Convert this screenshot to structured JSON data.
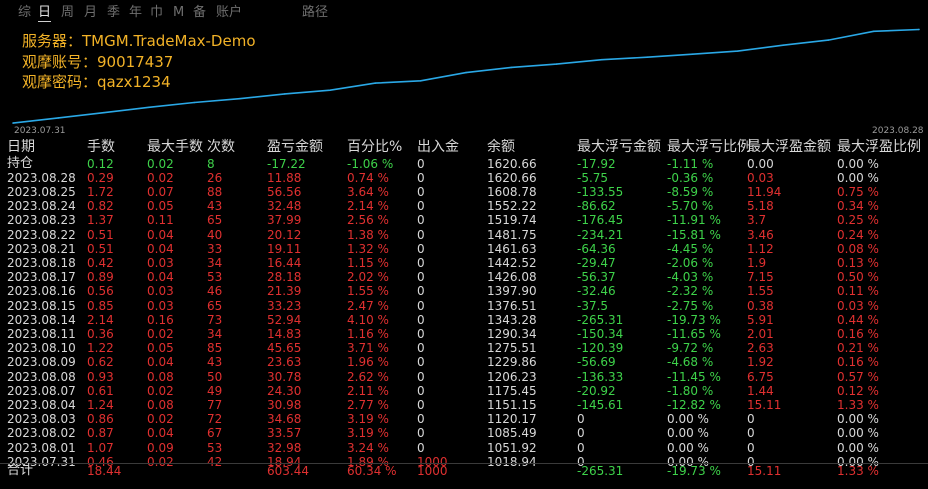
{
  "tabs": [
    {
      "label": "综",
      "active": false
    },
    {
      "label": "日",
      "active": true
    },
    {
      "label": "周",
      "active": false
    },
    {
      "label": "月",
      "active": false
    },
    {
      "label": "季",
      "active": false
    },
    {
      "label": "年",
      "active": false
    },
    {
      "label": "巾",
      "active": false
    },
    {
      "label": "M",
      "active": false
    },
    {
      "label": "备",
      "active": false
    },
    {
      "label": "账户",
      "active": false
    },
    {
      "label": "路径",
      "active": false
    }
  ],
  "info": {
    "server": "服务器：TMGM.TradeMax-Demo",
    "account": "观摩账号：90017437",
    "password": "观摩密码：qazx1234"
  },
  "chart_data": {
    "type": "line",
    "x_start": "2023.07.31",
    "x_end": "2023.08.28",
    "ylim": [
      1000,
      1630
    ],
    "color": "#2aa8e6",
    "x": [
      "2023.07.31",
      "2023.08.01",
      "2023.08.02",
      "2023.08.03",
      "2023.08.04",
      "2023.08.07",
      "2023.08.08",
      "2023.08.09",
      "2023.08.10",
      "2023.08.11",
      "2023.08.14",
      "2023.08.15",
      "2023.08.16",
      "2023.08.17",
      "2023.08.18",
      "2023.08.21",
      "2023.08.22",
      "2023.08.23",
      "2023.08.24",
      "2023.08.25",
      "2023.08.28"
    ],
    "values": [
      1018.94,
      1051.92,
      1085.49,
      1120.17,
      1151.15,
      1175.45,
      1206.23,
      1229.86,
      1275.51,
      1290.34,
      1343.28,
      1376.51,
      1397.9,
      1426.08,
      1442.52,
      1461.63,
      1481.75,
      1519.74,
      1552.22,
      1608.78,
      1620.66
    ]
  },
  "table": {
    "headers": [
      "日期",
      "手数",
      "最大手数",
      "次数",
      "盈亏金额",
      "百分比%",
      "出入金",
      "余额",
      "最大浮亏金额",
      "最大浮亏比例",
      "最大浮盈金额",
      "最大浮盈比例"
    ],
    "holding": {
      "date": "持仓",
      "lots": "0.12",
      "maxlots": "0.02",
      "count": "8",
      "pnl": "-17.22",
      "pct": "-1.06 %",
      "io": "0",
      "bal": "1620.66",
      "mfl": "-17.92",
      "mflp": "-1.11 %",
      "mfg": "0.00",
      "mfgp": "0.00 %"
    },
    "rows": [
      {
        "date": "2023.08.28",
        "lots": "0.29",
        "maxlots": "0.02",
        "count": "26",
        "pnl": "11.88",
        "pct": "0.74 %",
        "io": "0",
        "bal": "1620.66",
        "mfl": "-5.75",
        "mflp": "-0.36 %",
        "mfg": "0.03",
        "mfgp": "0.00 %"
      },
      {
        "date": "2023.08.25",
        "lots": "1.72",
        "maxlots": "0.07",
        "count": "88",
        "pnl": "56.56",
        "pct": "3.64 %",
        "io": "0",
        "bal": "1608.78",
        "mfl": "-133.55",
        "mflp": "-8.59 %",
        "mfg": "11.94",
        "mfgp": "0.75 %"
      },
      {
        "date": "2023.08.24",
        "lots": "0.82",
        "maxlots": "0.05",
        "count": "43",
        "pnl": "32.48",
        "pct": "2.14 %",
        "io": "0",
        "bal": "1552.22",
        "mfl": "-86.62",
        "mflp": "-5.70 %",
        "mfg": "5.18",
        "mfgp": "0.34 %"
      },
      {
        "date": "2023.08.23",
        "lots": "1.37",
        "maxlots": "0.11",
        "count": "65",
        "pnl": "37.99",
        "pct": "2.56 %",
        "io": "0",
        "bal": "1519.74",
        "mfl": "-176.45",
        "mflp": "-11.91 %",
        "mfg": "3.7",
        "mfgp": "0.25 %"
      },
      {
        "date": "2023.08.22",
        "lots": "0.51",
        "maxlots": "0.04",
        "count": "40",
        "pnl": "20.12",
        "pct": "1.38 %",
        "io": "0",
        "bal": "1481.75",
        "mfl": "-234.21",
        "mflp": "-15.81 %",
        "mfg": "3.46",
        "mfgp": "0.24 %"
      },
      {
        "date": "2023.08.21",
        "lots": "0.51",
        "maxlots": "0.04",
        "count": "33",
        "pnl": "19.11",
        "pct": "1.32 %",
        "io": "0",
        "bal": "1461.63",
        "mfl": "-64.36",
        "mflp": "-4.45 %",
        "mfg": "1.12",
        "mfgp": "0.08 %"
      },
      {
        "date": "2023.08.18",
        "lots": "0.42",
        "maxlots": "0.03",
        "count": "34",
        "pnl": "16.44",
        "pct": "1.15 %",
        "io": "0",
        "bal": "1442.52",
        "mfl": "-29.47",
        "mflp": "-2.06 %",
        "mfg": "1.9",
        "mfgp": "0.13 %"
      },
      {
        "date": "2023.08.17",
        "lots": "0.89",
        "maxlots": "0.04",
        "count": "53",
        "pnl": "28.18",
        "pct": "2.02 %",
        "io": "0",
        "bal": "1426.08",
        "mfl": "-56.37",
        "mflp": "-4.03 %",
        "mfg": "7.15",
        "mfgp": "0.50 %"
      },
      {
        "date": "2023.08.16",
        "lots": "0.56",
        "maxlots": "0.03",
        "count": "46",
        "pnl": "21.39",
        "pct": "1.55 %",
        "io": "0",
        "bal": "1397.90",
        "mfl": "-32.46",
        "mflp": "-2.32 %",
        "mfg": "1.55",
        "mfgp": "0.11 %"
      },
      {
        "date": "2023.08.15",
        "lots": "0.85",
        "maxlots": "0.03",
        "count": "65",
        "pnl": "33.23",
        "pct": "2.47 %",
        "io": "0",
        "bal": "1376.51",
        "mfl": "-37.5",
        "mflp": "-2.75 %",
        "mfg": "0.38",
        "mfgp": "0.03 %"
      },
      {
        "date": "2023.08.14",
        "lots": "2.14",
        "maxlots": "0.16",
        "count": "73",
        "pnl": "52.94",
        "pct": "4.10 %",
        "io": "0",
        "bal": "1343.28",
        "mfl": "-265.31",
        "mflp": "-19.73 %",
        "mfg": "5.91",
        "mfgp": "0.44 %"
      },
      {
        "date": "2023.08.11",
        "lots": "0.36",
        "maxlots": "0.02",
        "count": "34",
        "pnl": "14.83",
        "pct": "1.16 %",
        "io": "0",
        "bal": "1290.34",
        "mfl": "-150.34",
        "mflp": "-11.65 %",
        "mfg": "2.01",
        "mfgp": "0.16 %"
      },
      {
        "date": "2023.08.10",
        "lots": "1.22",
        "maxlots": "0.05",
        "count": "85",
        "pnl": "45.65",
        "pct": "3.71 %",
        "io": "0",
        "bal": "1275.51",
        "mfl": "-120.39",
        "mflp": "-9.72 %",
        "mfg": "2.63",
        "mfgp": "0.21 %"
      },
      {
        "date": "2023.08.09",
        "lots": "0.62",
        "maxlots": "0.04",
        "count": "43",
        "pnl": "23.63",
        "pct": "1.96 %",
        "io": "0",
        "bal": "1229.86",
        "mfl": "-56.69",
        "mflp": "-4.68 %",
        "mfg": "1.92",
        "mfgp": "0.16 %"
      },
      {
        "date": "2023.08.08",
        "lots": "0.93",
        "maxlots": "0.08",
        "count": "50",
        "pnl": "30.78",
        "pct": "2.62 %",
        "io": "0",
        "bal": "1206.23",
        "mfl": "-136.33",
        "mflp": "-11.45 %",
        "mfg": "6.75",
        "mfgp": "0.57 %"
      },
      {
        "date": "2023.08.07",
        "lots": "0.61",
        "maxlots": "0.02",
        "count": "49",
        "pnl": "24.30",
        "pct": "2.11 %",
        "io": "0",
        "bal": "1175.45",
        "mfl": "-20.92",
        "mflp": "-1.80 %",
        "mfg": "1.44",
        "mfgp": "0.12 %"
      },
      {
        "date": "2023.08.04",
        "lots": "1.24",
        "maxlots": "0.08",
        "count": "77",
        "pnl": "30.98",
        "pct": "2.77 %",
        "io": "0",
        "bal": "1151.15",
        "mfl": "-145.61",
        "mflp": "-12.82 %",
        "mfg": "15.11",
        "mfgp": "1.33 %"
      },
      {
        "date": "2023.08.03",
        "lots": "0.86",
        "maxlots": "0.02",
        "count": "72",
        "pnl": "34.68",
        "pct": "3.19 %",
        "io": "0",
        "bal": "1120.17",
        "mfl": "0",
        "mflp": "0.00 %",
        "mfg": "0",
        "mfgp": "0.00 %"
      },
      {
        "date": "2023.08.02",
        "lots": "0.87",
        "maxlots": "0.04",
        "count": "67",
        "pnl": "33.57",
        "pct": "3.19 %",
        "io": "0",
        "bal": "1085.49",
        "mfl": "0",
        "mflp": "0.00 %",
        "mfg": "0",
        "mfgp": "0.00 %"
      },
      {
        "date": "2023.08.01",
        "lots": "1.07",
        "maxlots": "0.09",
        "count": "53",
        "pnl": "32.98",
        "pct": "3.24 %",
        "io": "0",
        "bal": "1051.92",
        "mfl": "0",
        "mflp": "0.00 %",
        "mfg": "0",
        "mfgp": "0.00 %"
      },
      {
        "date": "2023.07.31",
        "lots": "0.46",
        "maxlots": "0.02",
        "count": "42",
        "pnl": "18.94",
        "pct": "1.89 %",
        "io": "1000",
        "bal": "1018.94",
        "mfl": "0",
        "mflp": "0.00 %",
        "mfg": "0",
        "mfgp": "0.00 %"
      }
    ],
    "total": {
      "date": "合计",
      "lots": "18.44",
      "maxlots": "",
      "count": "",
      "pnl": "603.44",
      "pct": "60.34 %",
      "io": "1000",
      "bal": "",
      "mfl": "-265.31",
      "mflp": "-19.73 %",
      "mfg": "15.11",
      "mfgp": "1.33 %"
    }
  },
  "colors": {
    "red": "#e03030",
    "green": "#3ed24a",
    "white": "#d8d8d8",
    "accent": "#f2b227",
    "line": "#2aa8e6"
  }
}
